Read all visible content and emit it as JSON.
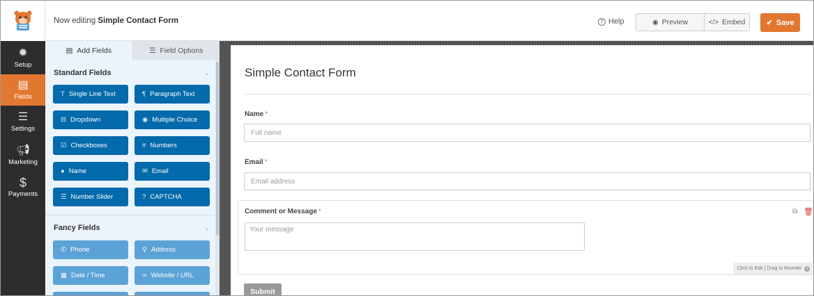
{
  "header": {
    "editing_prefix": "Now editing",
    "form_name": "Simple Contact Form",
    "help_label": "Help",
    "preview_label": "Preview",
    "embed_label": "Embed",
    "save_label": "Save",
    "accent_color": "#e27730"
  },
  "nav": {
    "items": [
      {
        "label": "Setup",
        "icon": "gear-icon"
      },
      {
        "label": "Fields",
        "icon": "fields-icon",
        "active": true
      },
      {
        "label": "Settings",
        "icon": "sliders-icon"
      },
      {
        "label": "Marketing",
        "icon": "megaphone-icon"
      },
      {
        "label": "Payments",
        "icon": "dollar-icon"
      }
    ]
  },
  "panel": {
    "tabs": [
      {
        "label": "Add Fields",
        "active": true
      },
      {
        "label": "Field Options",
        "active": false
      }
    ],
    "standard": {
      "title": "Standard Fields",
      "buttons": [
        "Single Line Text",
        "Paragraph Text",
        "Dropdown",
        "Multiple Choice",
        "Checkboxes",
        "Numbers",
        "Name",
        "Email",
        "Number Slider",
        "CAPTCHA"
      ]
    },
    "fancy": {
      "title": "Fancy Fields",
      "buttons": [
        "Phone",
        "Address",
        "Date / Time",
        "Website / URL"
      ]
    },
    "button_color": "#036aab",
    "fancy_button_color": "#5ba3d6"
  },
  "form": {
    "title": "Simple Contact Form",
    "fields": [
      {
        "label": "Name",
        "required": "*",
        "placeholder": "Full name"
      },
      {
        "label": "Email",
        "required": "*",
        "placeholder": "Email address"
      },
      {
        "label": "Comment or Message",
        "required": "*",
        "placeholder": "Your message"
      }
    ],
    "hint": "Click to Edit | Drag to Reorder",
    "submit_label": "Submit"
  }
}
